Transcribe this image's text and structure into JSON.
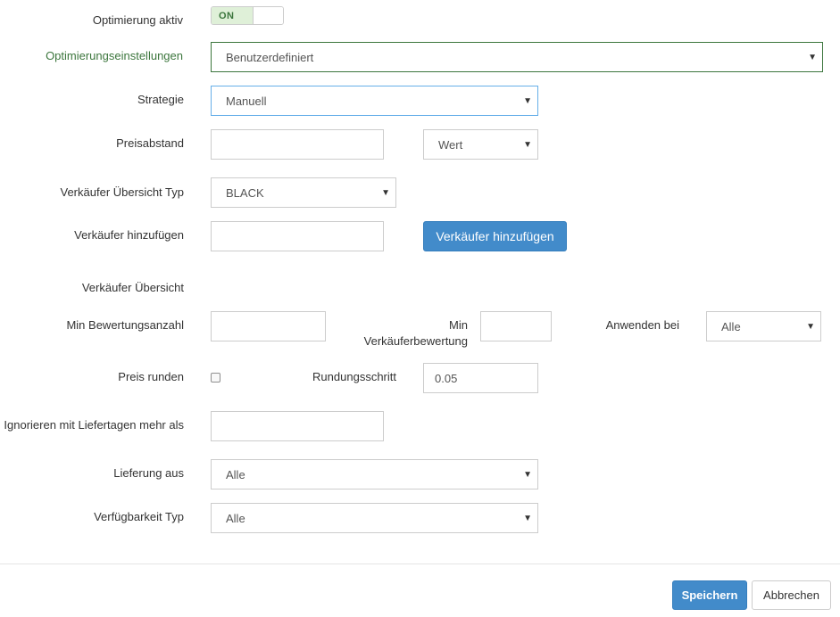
{
  "form": {
    "optimization_active": {
      "label": "Optimierung aktiv",
      "toggle_text": "ON"
    },
    "optimization_settings": {
      "label": "Optimierungseinstellungen",
      "value": "Benutzerdefiniert"
    },
    "strategy": {
      "label": "Strategie",
      "value": "Manuell"
    },
    "price_gap": {
      "label": "Preisabstand",
      "value": "",
      "unit_value": "Wert"
    },
    "seller_overview_type": {
      "label": "Verkäufer Übersicht Typ",
      "value": "BLACK"
    },
    "add_seller": {
      "label": "Verkäufer hinzufügen",
      "value": "",
      "button": "Verkäufer hinzufügen"
    },
    "seller_overview": {
      "label": "Verkäufer Übersicht"
    },
    "min_rating_count": {
      "label": "Min Bewertungsanzahl",
      "value": ""
    },
    "min_seller_rating": {
      "label_line1": "Min",
      "label_line2": "Verkäuferbewertung",
      "value": ""
    },
    "apply_at": {
      "label": "Anwenden bei",
      "value": "Alle"
    },
    "round_price": {
      "label": "Preis runden",
      "checked": false
    },
    "rounding_step": {
      "label": "Rundungsschritt",
      "value": "0.05"
    },
    "ignore_delivery_days": {
      "label": "Ignorieren mit Liefertagen mehr als",
      "value": ""
    },
    "delivery_from": {
      "label": "Lieferung aus",
      "value": "Alle"
    },
    "availability_type": {
      "label": "Verfügbarkeit Typ",
      "value": "Alle"
    }
  },
  "footer": {
    "save": "Speichern",
    "cancel": "Abbrechen"
  },
  "icons": {
    "dropdown": "caret-down-icon"
  },
  "colors": {
    "primary": "#428bca",
    "success_text": "#3c763d",
    "success_bg": "#dff0d8",
    "focus_border": "#66afe9",
    "border": "#cccccc"
  }
}
